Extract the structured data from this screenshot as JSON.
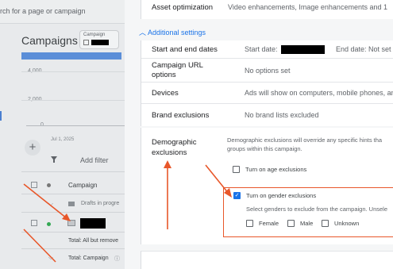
{
  "background": {
    "search_placeholder": "rch for a page or campaign",
    "page_title": "Campaigns",
    "campaign_chip_label": "Campaign",
    "chart_ticks": [
      "4,000",
      "2,000",
      "0"
    ],
    "chart_date": "Jul 1, 2025",
    "add_filter": "Add filter",
    "column_header": "Campaign",
    "drafts_label": "Drafts in progre",
    "total_all": "Total: All but remove",
    "total_campaign": "Total: Campaign"
  },
  "panel": {
    "asset_optimization": {
      "label": "Asset optimization",
      "value": "Video enhancements, Image enhancements and 1"
    },
    "additional_settings": "Additional settings",
    "rows": [
      {
        "label": "Start and end dates",
        "start_prefix": "Start date:",
        "end_text": "End date: Not set"
      },
      {
        "label": "Campaign URL options",
        "value": "No options set"
      },
      {
        "label": "Devices",
        "value": "Ads will show on computers, mobile phones, and ta"
      },
      {
        "label": "Brand exclusions",
        "value": "No brand lists excluded"
      }
    ],
    "demographic": {
      "label": "Demographic exclusions",
      "description_line1": "Demographic exclusions will override any specific hints tha",
      "description_line2": "groups within this campaign.",
      "age_label": "Turn on age exclusions",
      "age_checked": false,
      "gender_label": "Turn on gender exclusions",
      "gender_checked": true,
      "gender_hint": "Select genders to exclude from the campaign. Unsele",
      "options": [
        {
          "label": "Female",
          "checked": false
        },
        {
          "label": "Male",
          "checked": false
        },
        {
          "label": "Unknown",
          "checked": false
        }
      ]
    }
  },
  "colors": {
    "accent": "#1a73e8",
    "annotation": "#e8572a"
  }
}
